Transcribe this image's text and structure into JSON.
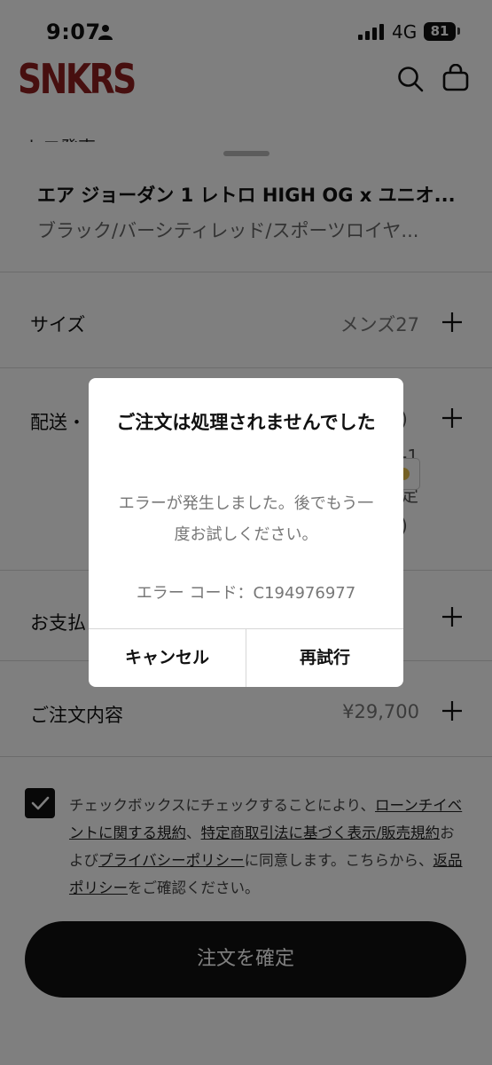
{
  "status_bar": {
    "time": "9:07",
    "network": "4G",
    "battery": "81"
  },
  "header": {
    "logo": "SNKRS",
    "behind_text": "トロ発売"
  },
  "product": {
    "name": "エア ジョーダン 1 レトロ HIGH OG x ユニオ...",
    "color": "ブラック/バーシティレッド/スポーツロイヤ..."
  },
  "rows": {
    "size": {
      "label": "サイズ",
      "value": "メンズ27"
    },
    "delivery": {
      "label": "配送・",
      "fragments": [
        ")",
        "-1",
        "定",
        ")"
      ]
    },
    "payment": {
      "label": "お支払"
    },
    "order": {
      "label": "ご注文内容",
      "value": "¥29,700"
    }
  },
  "consent": {
    "p1": "チェックボックスにチェックすることにより、",
    "link1": "ローンチイベントに関する規約",
    "p2": "、",
    "link2": "特定商取引法に基づく表示/販売規約",
    "p3": "および",
    "link3": "プライバシーポリシー",
    "p4": "に同意します。こちらから、",
    "link4": "返品ポリシー",
    "p5": "をご確認ください。"
  },
  "confirm_button": "注文を確定",
  "dialog": {
    "title": "ご注文は処理されませんでした",
    "message": "エラーが発生しました。後でもう一度お試しください。",
    "error_code": "エラー コード：C194976977",
    "cancel": "キャンセル",
    "retry": "再試行"
  },
  "icons": {
    "status": [
      "person-icon",
      "signal-icon",
      "battery-icon"
    ],
    "header": [
      "search-icon",
      "bag-icon"
    ],
    "rows": [
      "plus-icon"
    ],
    "consent": [
      "checkmark-icon"
    ]
  },
  "colors": {
    "logo": "#8e1f1f",
    "primary_button": "#111111",
    "overlay": "rgba(0,0,0,0.5)"
  }
}
